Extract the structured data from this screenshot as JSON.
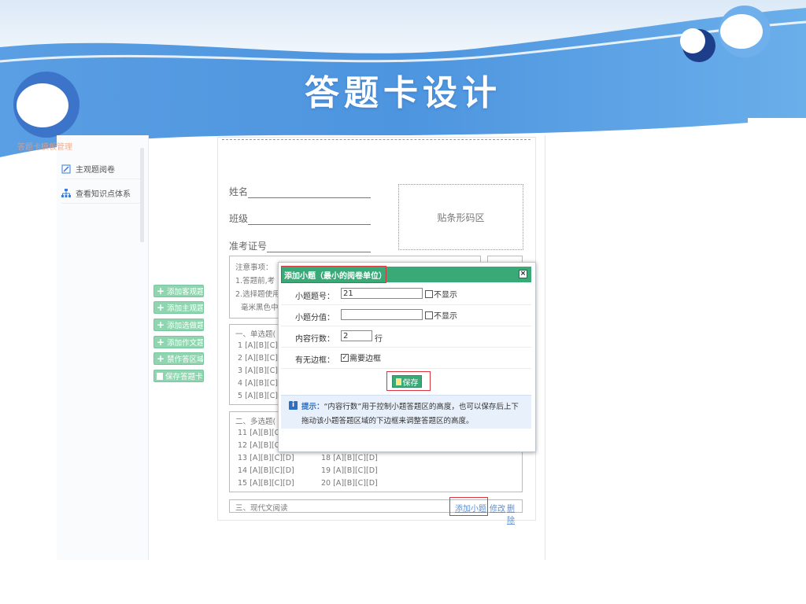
{
  "slide": {
    "title": "答题卡设计"
  },
  "leftnav": {
    "faded_header": "答题卡模板管理",
    "items": [
      {
        "label": "主观题阅卷",
        "icon": "edit-icon"
      },
      {
        "label": "查看知识点体系",
        "icon": "tree-icon"
      }
    ]
  },
  "actions": [
    {
      "label": "添加客观题"
    },
    {
      "label": "添加主观题"
    },
    {
      "label": "添加选做题"
    },
    {
      "label": "添加作文题"
    },
    {
      "label": "禁作答区域"
    },
    {
      "label": "保存答题卡"
    }
  ],
  "sheet": {
    "name_label": "姓名",
    "class_label": "班级",
    "exam_no_label": "准考证号",
    "barcode_label": "贴条形码区",
    "notice": {
      "title": "注意事项：",
      "lines": [
        "1.答题前,考",
        "2.选择题使用",
        "毫米黑色中"
      ]
    },
    "section1": {
      "title": "一、单选题(",
      "rows": [
        "1 [A][B][C]",
        "2 [A][B][C]",
        "3 [A][B][C]",
        "4 [A][B][C]",
        "5 [A][B][C]"
      ]
    },
    "section2": {
      "title": "二、多选题(",
      "rows_left": [
        "11 [A][B][C",
        "12 [A][B][C",
        "13 [A][B][C][D]",
        "14 [A][B][C][D]",
        "15 [A][B][C][D]"
      ],
      "rows_right": [
        "18 [A][B][C][D]",
        "19 [A][B][C][D]",
        "20 [A][B][C][D]"
      ]
    },
    "section3": {
      "title": "三、现代文阅读",
      "add_link": "添加小题",
      "edit_link": "修改",
      "delete_link": "删除"
    }
  },
  "dialog": {
    "title": "添加小题（最小的阅卷单位）",
    "fields": {
      "number": {
        "label": "小题题号：",
        "value": "21",
        "hide_label": "不显示"
      },
      "score": {
        "label": "小题分值：",
        "value": "",
        "hide_label": "不显示"
      },
      "lines": {
        "label": "内容行数：",
        "value": "2",
        "unit": "行"
      },
      "border": {
        "label": "有无边框：",
        "check_label": "需要边框",
        "checked": true
      }
    },
    "save_label": "保存",
    "tip": {
      "keyword": "提示：",
      "line1": "“内容行数”用于控制小题答题区的高度，也可以保存后上下",
      "line2": "拖动该小题答题区域的下边框来调整答题区的高度。"
    }
  }
}
